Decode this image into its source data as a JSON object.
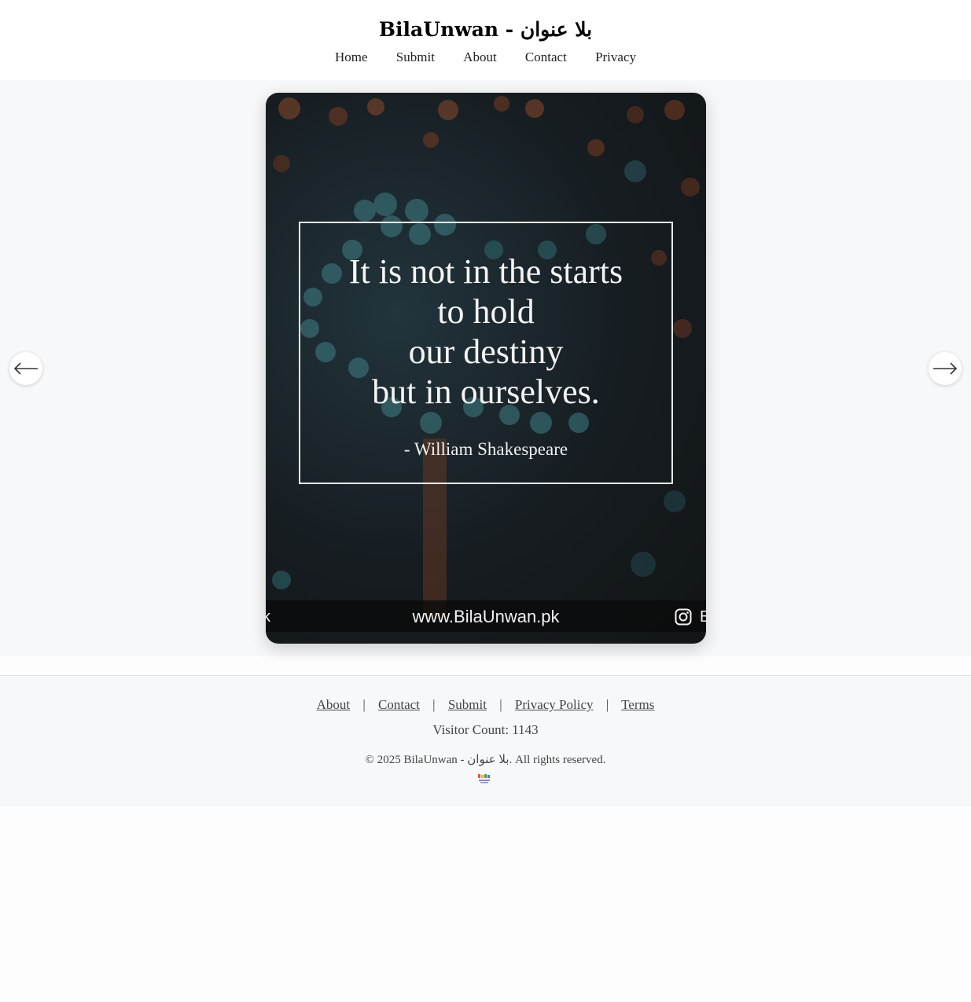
{
  "site": {
    "title": "BilaUnwan - بلا عنوان"
  },
  "nav": {
    "items": [
      {
        "label": "Home"
      },
      {
        "label": "Submit"
      },
      {
        "label": "About"
      },
      {
        "label": "Contact"
      },
      {
        "label": "Privacy"
      }
    ]
  },
  "slider": {
    "prev_icon": "arrow-left-icon",
    "next_icon": "arrow-right-icon",
    "slide": {
      "quote_lines": [
        "It is not in the starts",
        "to hold",
        "our destiny",
        "but in ourselves."
      ],
      "author": "- William Shakespeare",
      "watermark_url": "www.BilaUnwan.pk",
      "watermark_left_fragment": "k",
      "watermark_right_fragment": "B",
      "watermark_right_icon": "instagram-icon"
    }
  },
  "footer": {
    "links": [
      {
        "label": "About"
      },
      {
        "label": "Contact"
      },
      {
        "label": "Submit"
      },
      {
        "label": "Privacy Policy"
      },
      {
        "label": "Terms"
      }
    ],
    "separator": "|",
    "visitor_count": "Visitor Count: 1143",
    "copyright": "© 2025 BilaUnwan - بلا عنوان. All rights reserved.",
    "logo_icon": "site-logo-icon"
  },
  "colors": {
    "page_bg": "#fdfdfd",
    "header_bg": "#ffffff",
    "slider_bg": "#f7f8f9",
    "footer_bg": "#f7f8f9",
    "text": "#222222",
    "footer_text": "#444444"
  }
}
